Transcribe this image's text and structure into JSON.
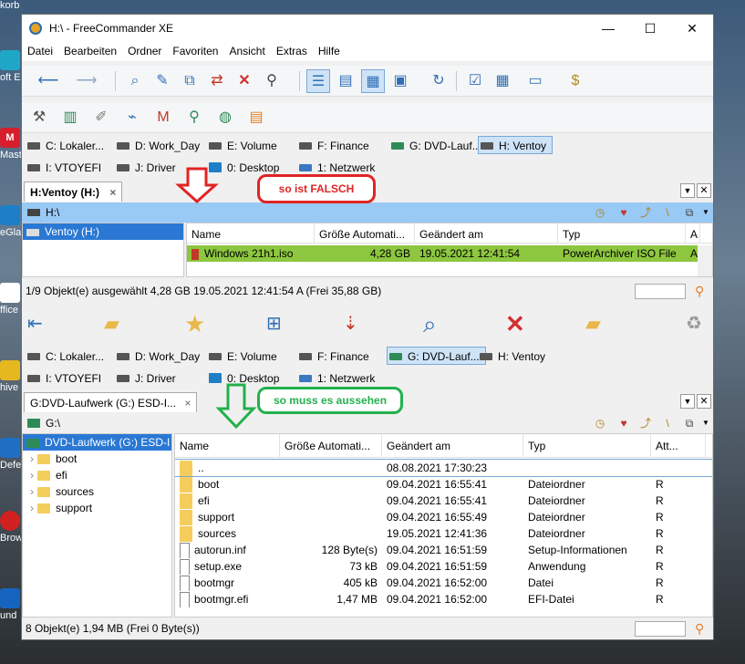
{
  "desktop": {
    "icons": [
      {
        "label": "korb"
      },
      {
        "label": "oft E"
      },
      {
        "label": "Mast"
      },
      {
        "label": "eGla"
      },
      {
        "label": "ffice"
      },
      {
        "label": "hive"
      },
      {
        "label": "Defe"
      },
      {
        "label": "Brow"
      },
      {
        "label": "und"
      }
    ]
  },
  "window": {
    "title": "H:\\ - FreeCommander XE",
    "minimize": "—",
    "maximize": "☐",
    "close": "✕"
  },
  "menu": [
    "Datei",
    "Bearbeiten",
    "Ordner",
    "Favoriten",
    "Ansicht",
    "Extras",
    "Hilfe"
  ],
  "drives": [
    {
      "label": "C: Lokaler..."
    },
    {
      "label": "D: Work_Day"
    },
    {
      "label": "E: Volume"
    },
    {
      "label": "F: Finance"
    },
    {
      "label": "G: DVD-Lauf..."
    },
    {
      "label": "H: Ventoy"
    },
    {
      "label": "I: VTOYEFI"
    },
    {
      "label": "J: Driver"
    },
    {
      "label": "0: Desktop"
    },
    {
      "label": "1: Netzwerk"
    }
  ],
  "top_panel": {
    "tab": "H:Ventoy (H:)",
    "tab_close": "×",
    "path": "H:\\",
    "tree_item": "Ventoy (H:)",
    "columns": [
      "Name",
      "Größe Automati...",
      "Geändert am",
      "Typ",
      "A"
    ],
    "rows": [
      {
        "name": "Windows 21h1.iso",
        "size": "4,28 GB",
        "date": "19.05.2021 12:41:54",
        "type": "PowerArchiver ISO File",
        "attr": "A"
      }
    ],
    "status": "1/9 Objekt(e) ausgewählt   4,28 GB   19.05.2021 12:41:54   A   (Frei 35,88 GB)"
  },
  "bottom_panel": {
    "tab": "G:DVD-Laufwerk (G:) ESD-I...",
    "tab_close": "×",
    "path": "G:\\",
    "tree_root": "DVD-Laufwerk (G:) ESD-I",
    "tree_items": [
      "boot",
      "efi",
      "sources",
      "support"
    ],
    "columns": [
      "Name",
      "Größe Automati...",
      "Geändert am",
      "Typ",
      "Att..."
    ],
    "rows": [
      {
        "name": "..",
        "size": "",
        "date": "08.08.2021 17:30:23",
        "type": "",
        "attr": "",
        "kind": "up"
      },
      {
        "name": "boot",
        "size": "",
        "date": "09.04.2021 16:55:41",
        "type": "Dateiordner",
        "attr": "R",
        "kind": "folder"
      },
      {
        "name": "efi",
        "size": "",
        "date": "09.04.2021 16:55:41",
        "type": "Dateiordner",
        "attr": "R",
        "kind": "folder"
      },
      {
        "name": "support",
        "size": "",
        "date": "09.04.2021 16:55:49",
        "type": "Dateiordner",
        "attr": "R",
        "kind": "folder"
      },
      {
        "name": "sources",
        "size": "",
        "date": "19.05.2021 12:41:36",
        "type": "Dateiordner",
        "attr": "R",
        "kind": "folder"
      },
      {
        "name": "autorun.inf",
        "size": "128 Byte(s)",
        "date": "09.04.2021 16:51:59",
        "type": "Setup-Informationen",
        "attr": "R",
        "kind": "file"
      },
      {
        "name": "setup.exe",
        "size": "73 kB",
        "date": "09.04.2021 16:51:59",
        "type": "Anwendung",
        "attr": "R",
        "kind": "file"
      },
      {
        "name": "bootmgr",
        "size": "405 kB",
        "date": "09.04.2021 16:52:00",
        "type": "Datei",
        "attr": "R",
        "kind": "file"
      },
      {
        "name": "bootmgr.efi",
        "size": "1,47 MB",
        "date": "09.04.2021 16:52:00",
        "type": "EFI-Datei",
        "attr": "R",
        "kind": "file"
      }
    ],
    "status": "8 Objekt(e)   1,94 MB   (Frei 0 Byte(s))"
  },
  "annotations": {
    "red": "so ist FALSCH",
    "green": "so muss es aussehen"
  },
  "colors": {
    "selected_row": "#8dc63f",
    "path_bar_active": "#99c9f5",
    "annotation_red": "#e02424",
    "annotation_green": "#22b14c"
  }
}
